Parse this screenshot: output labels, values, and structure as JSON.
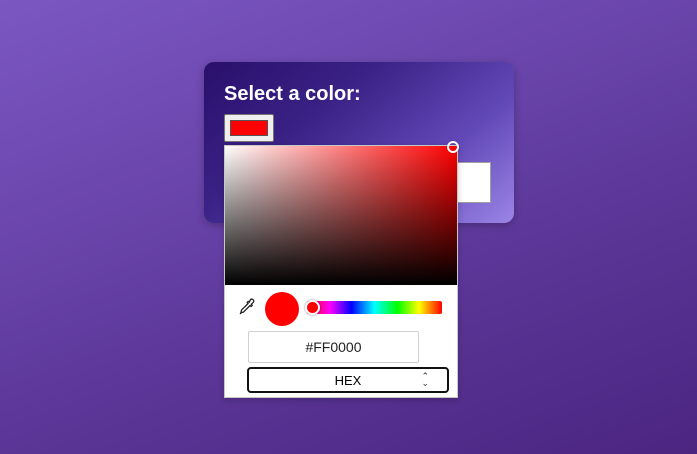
{
  "card": {
    "title": "Select a color:"
  },
  "picker": {
    "current_color": "#FF0000",
    "hex_value": "#FF0000",
    "format_selected": "HEX",
    "hue_position": 0
  },
  "icons": {
    "eyedropper": "eyedropper-icon",
    "chevron": "chevron-up-down-icon"
  },
  "colors": {
    "card_gradient_start": "#2a0f6b",
    "card_gradient_end": "#9b85e6",
    "selected": "#FF0000"
  }
}
